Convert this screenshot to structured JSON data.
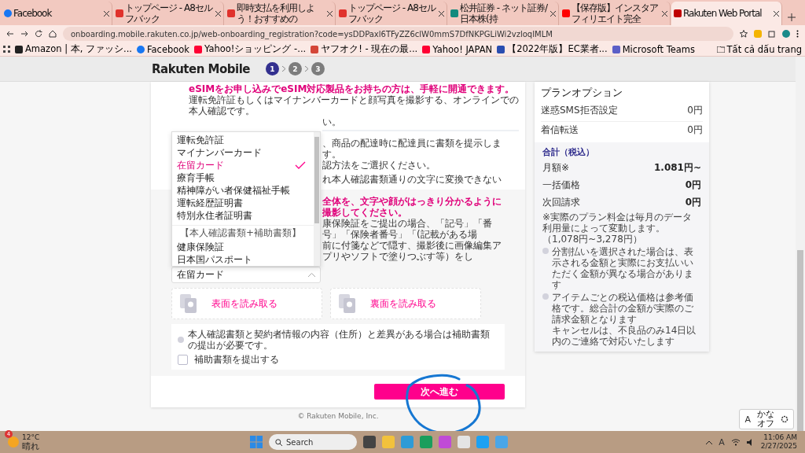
{
  "browser": {
    "tabs": [
      {
        "title": "Facebook",
        "kind": "facebook",
        "selected": false
      },
      {
        "title": "トップページ - A8セルフバック",
        "kind": "a8",
        "selected": false
      },
      {
        "title": "即時支払を利用しよう！おすすめの",
        "kind": "a8",
        "selected": false
      },
      {
        "title": "トップページ - A8セルフバック",
        "kind": "a8",
        "selected": false
      },
      {
        "title": "松井証券 - ネット証券/日本株(持",
        "kind": "matsui",
        "selected": false
      },
      {
        "title": "【保存版】インスタアフィリエイト完全",
        "kind": "youtube",
        "selected": false
      },
      {
        "title": "Rakuten Web Portal",
        "kind": "rakuten",
        "selected": true
      }
    ],
    "url": "onboarding.mobile.rakuten.co.jp/web-onboarding_registration?code=ysDDPaxl6TFyZZ6clW0mmS7DfNKPGLiWi2vzloqIMLM",
    "bookmarks": [
      {
        "label": "Amazon | 本, ファッシ...",
        "kind": "amazon"
      },
      {
        "label": "Facebook",
        "kind": "facebook"
      },
      {
        "label": "Yahoo!ショッピング -...",
        "kind": "yahoo"
      },
      {
        "label": "ヤフオク! - 現在の最...",
        "kind": "gmail"
      },
      {
        "label": "Yahoo! JAPAN",
        "kind": "yahoo"
      },
      {
        "label": "【2022年版】EC業者...",
        "kind": "mail"
      },
      {
        "label": "Microsoft Teams",
        "kind": "teams"
      }
    ],
    "all_bookmarks": "Tất cả dấu trang"
  },
  "page": {
    "logo": "Rakuten Mobile",
    "steps": [
      {
        "label": "1",
        "selected": true
      },
      {
        "label": "2",
        "selected": false
      },
      {
        "label": "3",
        "selected": false
      }
    ],
    "intro": {
      "notice": "eSIMをお申し込みでeSIM対応製品をお持ちの方は、手軽に開通できます。",
      "lines": [
        "運転免許証もしくはマイナンバーカードと顔写真を撮影する、オンラインでの本人確認です。",
        "い。"
      ]
    },
    "delivery_lines": [
      "、商品の配達時に配達員に書類を提示します。",
      "認方法をご選択ください。"
    ],
    "conversion_line": "れ本人確認書類通りの文字に変換できない",
    "photo_notice": "全体を、文字や顔がはっきり分かるように撮影してください。",
    "photo_lines": [
      "康保険証をご提出の場合、「記号」「番号」「保険者番号」「(記載がある場",
      "前に付箋などで隠す、撮影後に画像編集アプリやソフトで塗りつぶす等）をし"
    ],
    "document_menu": [
      {
        "label": "運転免許証",
        "kind": "option",
        "selected": false
      },
      {
        "label": "マイナンバーカード",
        "kind": "option",
        "selected": false
      },
      {
        "label": "在留カード",
        "kind": "option",
        "selected": true
      },
      {
        "label": "療育手帳",
        "kind": "option",
        "selected": false
      },
      {
        "label": "精神障がい者保健福祉手帳",
        "kind": "option",
        "selected": false
      },
      {
        "label": "運転経歴証明書",
        "kind": "option",
        "selected": false
      },
      {
        "label": "特別永住者証明書",
        "kind": "option",
        "selected": false
      },
      {
        "label": "【本人確認書類+補助書類】",
        "kind": "group",
        "selected": false
      },
      {
        "label": "健康保険証",
        "kind": "option",
        "selected": false
      },
      {
        "label": "日本国パスポート",
        "kind": "option",
        "selected": false
      }
    ],
    "document_select": {
      "value": "在留カード",
      "expanded": true
    },
    "uploads": [
      "表面を読み取る",
      "裏面を読み取る"
    ],
    "supplement": {
      "info": "本人確認書類と契約者情報の内容（住所）と差異がある場合は補助書類の提出が必要です。",
      "checkbox": {
        "label": "補助書類を提出する",
        "checked": false
      }
    },
    "next_button": "次へ進む",
    "copyright": "© Rakuten Mobile, Inc."
  },
  "summary": {
    "section": "プランオプション",
    "options": [
      {
        "label": "迷惑SMS拒否設定",
        "price": "0円"
      },
      {
        "label": "着信転送",
        "price": "0円"
      }
    ],
    "total_title": "合計（税込）",
    "totals": [
      {
        "label": "月額※",
        "price": "1.081円~"
      },
      {
        "label": "一括価格",
        "price": "0円"
      },
      {
        "label": "次回請求",
        "price": "0円"
      }
    ],
    "note": "※実際のプラン料金は毎月のデータ利用量によって変動します。（1,078円~3,278円）",
    "bullets": [
      [
        "分割払いを選択された場合は、表示される金額と実際にお支払いいただく金額が異なる場合があります"
      ],
      [
        "アイテムごとの税込価格は参考価格です。総合計の金額が実際のご請求金額となります",
        "キャンセルは、不良品のみ14日以内のご連絡で対応いたします"
      ]
    ]
  },
  "ime": {
    "letter": "A",
    "mode": [
      "かな",
      "オフ"
    ]
  },
  "taskbar": {
    "temperature": "12°C",
    "weather": "晴れ",
    "weather_badge": "4",
    "search": "Search",
    "tray_letter": "A",
    "time": "11:06 AM",
    "date": "2/27/2025"
  }
}
